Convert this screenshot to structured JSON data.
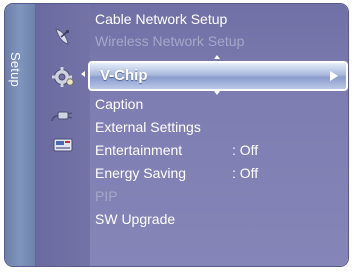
{
  "side_tab": {
    "label": "Setup"
  },
  "icons": [
    {
      "name": "satellite-dish-icon"
    },
    {
      "name": "gear-icon"
    },
    {
      "name": "plug-icon"
    },
    {
      "name": "screen-icon"
    }
  ],
  "menu": {
    "items": [
      {
        "label": "Cable Network Setup",
        "enabled": true
      },
      {
        "label": "Wireless Network Setup",
        "enabled": false
      },
      {
        "label": "V-Chip",
        "selected": true
      },
      {
        "label": "Caption",
        "enabled": true
      },
      {
        "label": "External Settings",
        "enabled": true
      },
      {
        "label": "Entertainment",
        "value": ": Off",
        "enabled": true
      },
      {
        "label": "Energy Saving",
        "value": ": Off",
        "enabled": true
      },
      {
        "label": "PIP",
        "enabled": false
      },
      {
        "label": "SW Upgrade",
        "enabled": true
      }
    ]
  },
  "colors": {
    "menu_background": "#7e7eb2",
    "side_tab": "#7e95bd",
    "selected_highlight": "#aab9dc",
    "disabled_text": "#a7a7ca"
  }
}
